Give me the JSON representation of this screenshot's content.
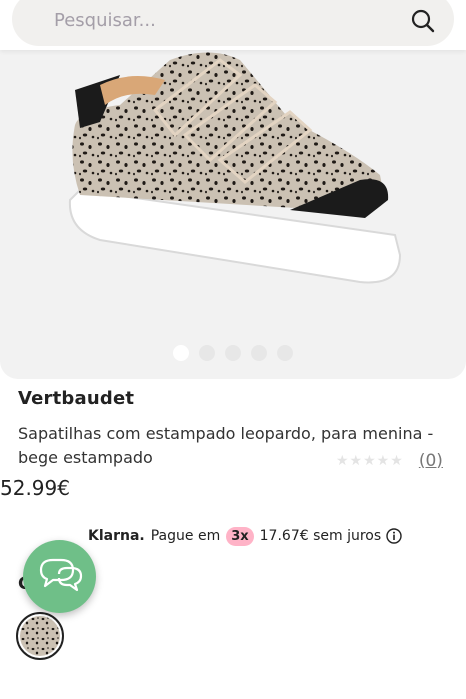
{
  "search": {
    "placeholder": "Pesquisar..."
  },
  "gallery": {
    "dots": 5,
    "active_dot": 0
  },
  "product": {
    "brand": "Vertbaudet",
    "title": "Sapatilhas com estampado leopardo, para menina - bege estampado",
    "rating_stars": "★★★★★",
    "review_count": "(0)",
    "price": "52.99€"
  },
  "klarna": {
    "logo": "Klarna.",
    "text_before": "Pague em",
    "installments": "3x",
    "text_after": "17.67€ sem juros"
  },
  "color": {
    "label": "C"
  },
  "icons": {
    "search": "search-icon",
    "info": "info-icon",
    "chat": "chat-icon"
  },
  "colors": {
    "search_bg": "#f1f0ee",
    "gallery_bg": "#f2f2f2",
    "klarna_badge": "#ffb3c7",
    "chat_button": "#6fbf88"
  }
}
